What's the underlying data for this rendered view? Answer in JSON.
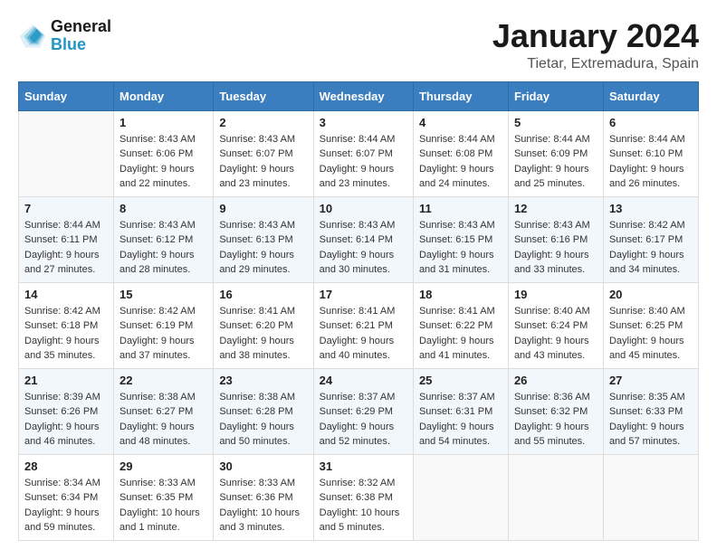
{
  "header": {
    "logo_line1": "General",
    "logo_line2": "Blue",
    "main_title": "January 2024",
    "subtitle": "Tietar, Extremadura, Spain"
  },
  "calendar": {
    "days_of_week": [
      "Sunday",
      "Monday",
      "Tuesday",
      "Wednesday",
      "Thursday",
      "Friday",
      "Saturday"
    ],
    "weeks": [
      [
        {
          "day": "",
          "info": ""
        },
        {
          "day": "1",
          "info": "Sunrise: 8:43 AM\nSunset: 6:06 PM\nDaylight: 9 hours\nand 22 minutes."
        },
        {
          "day": "2",
          "info": "Sunrise: 8:43 AM\nSunset: 6:07 PM\nDaylight: 9 hours\nand 23 minutes."
        },
        {
          "day": "3",
          "info": "Sunrise: 8:44 AM\nSunset: 6:07 PM\nDaylight: 9 hours\nand 23 minutes."
        },
        {
          "day": "4",
          "info": "Sunrise: 8:44 AM\nSunset: 6:08 PM\nDaylight: 9 hours\nand 24 minutes."
        },
        {
          "day": "5",
          "info": "Sunrise: 8:44 AM\nSunset: 6:09 PM\nDaylight: 9 hours\nand 25 minutes."
        },
        {
          "day": "6",
          "info": "Sunrise: 8:44 AM\nSunset: 6:10 PM\nDaylight: 9 hours\nand 26 minutes."
        }
      ],
      [
        {
          "day": "7",
          "info": "Sunrise: 8:44 AM\nSunset: 6:11 PM\nDaylight: 9 hours\nand 27 minutes."
        },
        {
          "day": "8",
          "info": "Sunrise: 8:43 AM\nSunset: 6:12 PM\nDaylight: 9 hours\nand 28 minutes."
        },
        {
          "day": "9",
          "info": "Sunrise: 8:43 AM\nSunset: 6:13 PM\nDaylight: 9 hours\nand 29 minutes."
        },
        {
          "day": "10",
          "info": "Sunrise: 8:43 AM\nSunset: 6:14 PM\nDaylight: 9 hours\nand 30 minutes."
        },
        {
          "day": "11",
          "info": "Sunrise: 8:43 AM\nSunset: 6:15 PM\nDaylight: 9 hours\nand 31 minutes."
        },
        {
          "day": "12",
          "info": "Sunrise: 8:43 AM\nSunset: 6:16 PM\nDaylight: 9 hours\nand 33 minutes."
        },
        {
          "day": "13",
          "info": "Sunrise: 8:42 AM\nSunset: 6:17 PM\nDaylight: 9 hours\nand 34 minutes."
        }
      ],
      [
        {
          "day": "14",
          "info": "Sunrise: 8:42 AM\nSunset: 6:18 PM\nDaylight: 9 hours\nand 35 minutes."
        },
        {
          "day": "15",
          "info": "Sunrise: 8:42 AM\nSunset: 6:19 PM\nDaylight: 9 hours\nand 37 minutes."
        },
        {
          "day": "16",
          "info": "Sunrise: 8:41 AM\nSunset: 6:20 PM\nDaylight: 9 hours\nand 38 minutes."
        },
        {
          "day": "17",
          "info": "Sunrise: 8:41 AM\nSunset: 6:21 PM\nDaylight: 9 hours\nand 40 minutes."
        },
        {
          "day": "18",
          "info": "Sunrise: 8:41 AM\nSunset: 6:22 PM\nDaylight: 9 hours\nand 41 minutes."
        },
        {
          "day": "19",
          "info": "Sunrise: 8:40 AM\nSunset: 6:24 PM\nDaylight: 9 hours\nand 43 minutes."
        },
        {
          "day": "20",
          "info": "Sunrise: 8:40 AM\nSunset: 6:25 PM\nDaylight: 9 hours\nand 45 minutes."
        }
      ],
      [
        {
          "day": "21",
          "info": "Sunrise: 8:39 AM\nSunset: 6:26 PM\nDaylight: 9 hours\nand 46 minutes."
        },
        {
          "day": "22",
          "info": "Sunrise: 8:38 AM\nSunset: 6:27 PM\nDaylight: 9 hours\nand 48 minutes."
        },
        {
          "day": "23",
          "info": "Sunrise: 8:38 AM\nSunset: 6:28 PM\nDaylight: 9 hours\nand 50 minutes."
        },
        {
          "day": "24",
          "info": "Sunrise: 8:37 AM\nSunset: 6:29 PM\nDaylight: 9 hours\nand 52 minutes."
        },
        {
          "day": "25",
          "info": "Sunrise: 8:37 AM\nSunset: 6:31 PM\nDaylight: 9 hours\nand 54 minutes."
        },
        {
          "day": "26",
          "info": "Sunrise: 8:36 AM\nSunset: 6:32 PM\nDaylight: 9 hours\nand 55 minutes."
        },
        {
          "day": "27",
          "info": "Sunrise: 8:35 AM\nSunset: 6:33 PM\nDaylight: 9 hours\nand 57 minutes."
        }
      ],
      [
        {
          "day": "28",
          "info": "Sunrise: 8:34 AM\nSunset: 6:34 PM\nDaylight: 9 hours\nand 59 minutes."
        },
        {
          "day": "29",
          "info": "Sunrise: 8:33 AM\nSunset: 6:35 PM\nDaylight: 10 hours\nand 1 minute."
        },
        {
          "day": "30",
          "info": "Sunrise: 8:33 AM\nSunset: 6:36 PM\nDaylight: 10 hours\nand 3 minutes."
        },
        {
          "day": "31",
          "info": "Sunrise: 8:32 AM\nSunset: 6:38 PM\nDaylight: 10 hours\nand 5 minutes."
        },
        {
          "day": "",
          "info": ""
        },
        {
          "day": "",
          "info": ""
        },
        {
          "day": "",
          "info": ""
        }
      ]
    ]
  }
}
